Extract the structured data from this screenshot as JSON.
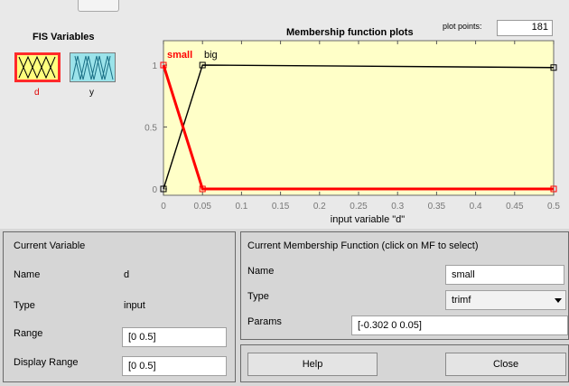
{
  "fis": {
    "title": "FIS Variables",
    "variables": [
      {
        "label": "d",
        "selected": true,
        "fill": "#ffff7e"
      },
      {
        "label": "y",
        "selected": false,
        "fill": "#9be3ea"
      }
    ]
  },
  "plot": {
    "title": "Membership function plots",
    "points_label": "plot points:",
    "points_value": "181"
  },
  "chart_data": {
    "type": "line",
    "xlabel": "input variable \"d\"",
    "xlim": [
      0,
      0.5
    ],
    "ylim": [
      0,
      1
    ],
    "x_ticks": [
      "0",
      "0.05",
      "0.1",
      "0.15",
      "0.2",
      "0.25",
      "0.3",
      "0.35",
      "0.4",
      "0.45",
      "0.5"
    ],
    "y_ticks": [
      "0",
      "0.5",
      "1"
    ],
    "background": "#ffffc8",
    "series": [
      {
        "name": "small",
        "selected": true,
        "color": "#ff0000",
        "points": [
          [
            0,
            1
          ],
          [
            0.05,
            0
          ],
          [
            0.5,
            0
          ]
        ]
      },
      {
        "name": "big",
        "selected": false,
        "color": "#000000",
        "points": [
          [
            0,
            0
          ],
          [
            0.05,
            1
          ],
          [
            0.5,
            0.98
          ]
        ]
      }
    ]
  },
  "current_variable": {
    "title": "Current Variable",
    "name_label": "Name",
    "name_value": "d",
    "type_label": "Type",
    "type_value": "input",
    "range_label": "Range",
    "range_value": "[0 0.5]",
    "display_range_label": "Display Range",
    "display_range_value": "[0 0.5]"
  },
  "current_mf": {
    "title": "Current Membership Function (click on MF to select)",
    "name_label": "Name",
    "name_value": "small",
    "type_label": "Type",
    "type_value": "trimf",
    "params_label": "Params",
    "params_value": "[-0.302 0 0.05]"
  },
  "buttons": {
    "help": "Help",
    "close": "Close"
  }
}
